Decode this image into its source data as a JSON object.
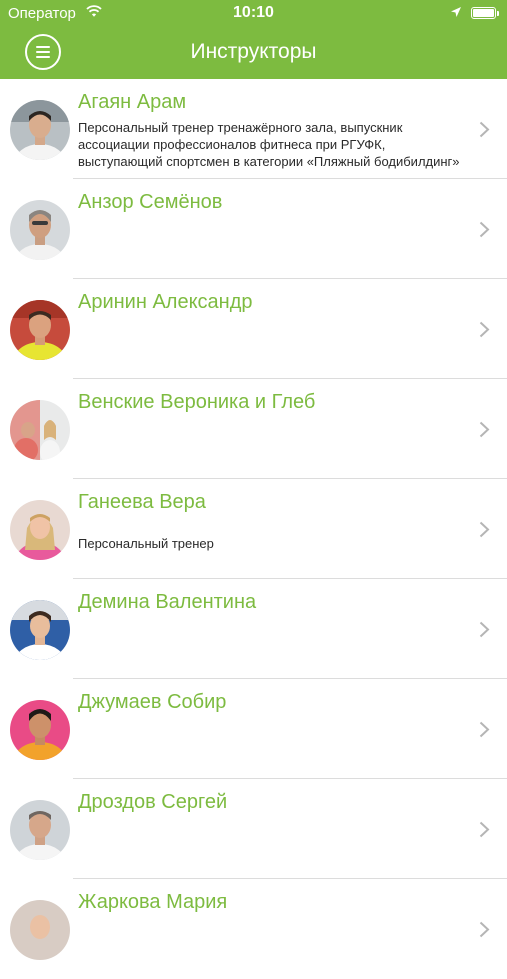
{
  "status_bar": {
    "carrier": "Оператор",
    "time": "10:10"
  },
  "nav": {
    "title": "Инструкторы",
    "menu_icon": "hamburger-menu-icon"
  },
  "colors": {
    "accent": "#7dbb40",
    "separator": "#dcdcdc",
    "chevron": "#b5b5b5"
  },
  "instructors": [
    {
      "name": "Агаян Арам",
      "description_lines": [
        "Персональный тренер тренажёрного зала, выпускник",
        "ассоциации профессионалов фитнеса при РГУФК,",
        "выступающий спортсмен в категории «Пляжный бодибилдинг»"
      ]
    },
    {
      "name": "Анзор Семёнов",
      "description": ""
    },
    {
      "name": "Аринин Александр",
      "description": ""
    },
    {
      "name": "Венские Вероника и Глеб",
      "description": ""
    },
    {
      "name": "Ганеева Вера",
      "description": "Персональный тренер"
    },
    {
      "name": "Демина Валентина",
      "description": ""
    },
    {
      "name": "Джумаев Собир",
      "description": ""
    },
    {
      "name": "Дроздов Сергей",
      "description": ""
    },
    {
      "name": "Жаркова Мария",
      "description": ""
    }
  ]
}
